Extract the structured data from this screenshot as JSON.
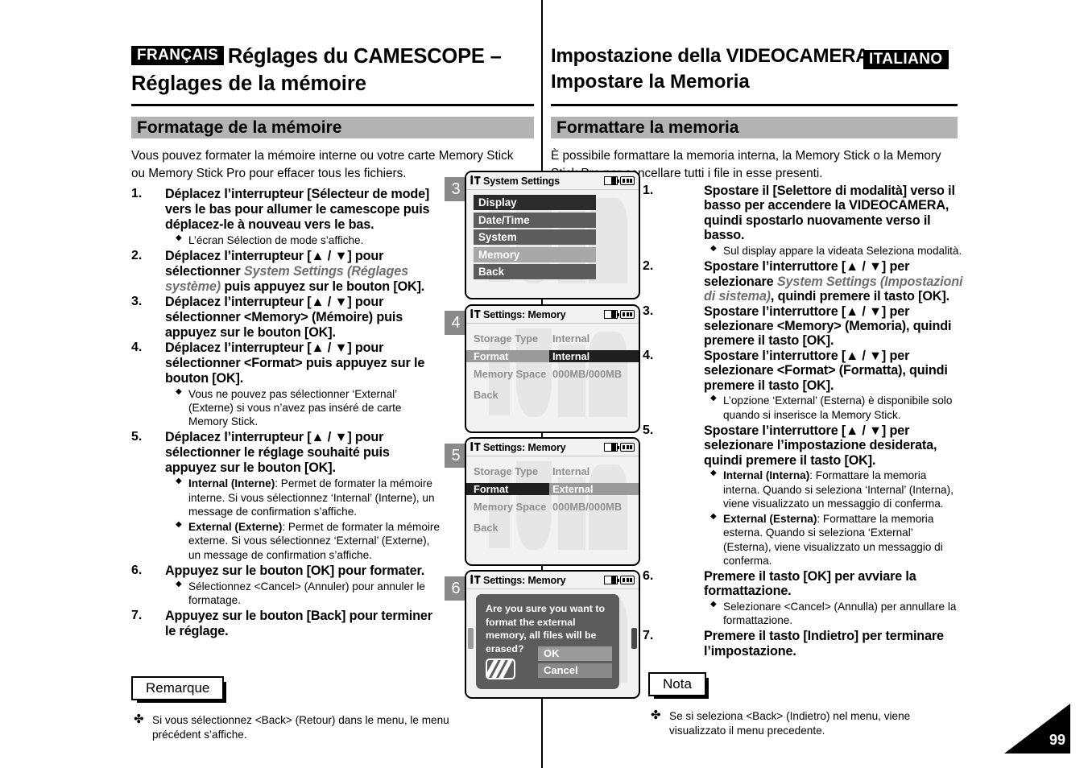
{
  "headers": {
    "french": {
      "lang_tag": "FRANÇAIS",
      "title_line1": "Réglages du CAMESCOPE –",
      "title_line2": "Réglages de la mémoire",
      "section_bar": "Formatage de la mémoire",
      "intro": "Vous pouvez formater la mémoire interne ou votre carte Memory Stick ou Memory Stick Pro pour effacer tous les fichiers."
    },
    "italian": {
      "lang_tag": "ITALIANO",
      "title_line1": "Impostazione della VIDEOCAMERA:",
      "title_line2": "Impostare la Memoria",
      "section_bar": "Formattare la memoria",
      "intro": "È possibile formattare la memoria interna, la Memory Stick o la Memory Stick Pro per cancellare tutti i file in esse presenti."
    }
  },
  "french_steps": [
    {
      "num": "1.",
      "text_pre": "Déplacez l’interrupteur [Sélecteur de mode] vers le bas pour allumer le camescope puis déplacez-le à nouveau vers le bas.",
      "italic": "",
      "text_post": "",
      "bullets": [
        {
          "pre": "",
          "bold": "",
          "post": "L’écran Sélection de mode s’affiche."
        }
      ]
    },
    {
      "num": "2.",
      "text_pre": "Déplacez l’interrupteur [▲ / ▼] pour sélectionner ",
      "italic": "System Settings (Réglages système)",
      "text_post": " puis appuyez sur le bouton [OK].",
      "bullets": []
    },
    {
      "num": "3.",
      "text_pre": "Déplacez l’interrupteur [▲ / ▼] pour sélectionner <Memory> (Mémoire) puis appuyez sur le bouton [OK].",
      "italic": "",
      "text_post": "",
      "bullets": []
    },
    {
      "num": "4.",
      "text_pre": "Déplacez l’interrupteur [▲ / ▼] pour sélectionner <Format> puis appuyez sur le bouton [OK].",
      "italic": "",
      "text_post": "",
      "bullets": [
        {
          "pre": "",
          "bold": "",
          "post": "Vous ne pouvez pas sélectionner ‘External’ (Externe) si vous n’avez pas inséré de carte Memory Stick."
        }
      ]
    },
    {
      "num": "5.",
      "text_pre": "Déplacez l’interrupteur [▲ / ▼] pour sélectionner le réglage souhaité puis appuyez sur le bouton [OK].",
      "italic": "",
      "text_post": "",
      "bullets": [
        {
          "pre": "",
          "bold": "Internal (Interne)",
          "post": ": Permet de formater la mémoire interne. Si vous sélectionnez ‘Internal’ (Interne), un message de confirmation s’affiche."
        },
        {
          "pre": "",
          "bold": "External (Externe)",
          "post": ": Permet de formater la mémoire externe. Si vous sélectionnez ‘External’ (Externe), un message de confirmation s’affiche."
        }
      ]
    },
    {
      "num": "6.",
      "text_pre": "Appuyez sur le bouton [OK] pour formater.",
      "italic": "",
      "text_post": "",
      "bullets": [
        {
          "pre": "",
          "bold": "",
          "post": "Sélectionnez <Cancel> (Annuler) pour annuler le formatage."
        }
      ]
    },
    {
      "num": "7.",
      "text_pre": "Appuyez sur le bouton [Back] pour terminer le réglage.",
      "italic": "",
      "text_post": "",
      "bullets": []
    }
  ],
  "italian_steps": [
    {
      "num": "1.",
      "text_pre": "Spostare il [Selettore di modalità]  verso il basso per accendere la VIDEOCAMERA, quindi  spostarlo nuovamente verso il basso.",
      "italic": "",
      "text_post": "",
      "bullets": [
        {
          "pre": "",
          "bold": "",
          "post": "Sul display appare la videata Seleziona modalità."
        }
      ]
    },
    {
      "num": "2.",
      "text_pre": "Spostare l’interruttore [▲ / ▼] per selezionare ",
      "italic": "System Settings (Impostazioni di sistema)",
      "text_post": ", quindi premere il tasto [OK].",
      "bullets": []
    },
    {
      "num": "3.",
      "text_pre": "Spostare l’interruttore [▲ / ▼] per selezionare <Memory> (Memoria), quindi premere il tasto [OK].",
      "italic": "",
      "text_post": "",
      "bullets": []
    },
    {
      "num": "4.",
      "text_pre": "Spostare l’interruttore [▲ / ▼] per selezionare <Format> (Formatta), quindi premere il tasto [OK].",
      "italic": "",
      "text_post": "",
      "bullets": [
        {
          "pre": "",
          "bold": "",
          "post": "L’opzione ‘External’ (Esterna) è disponibile solo quando si inserisce la Memory Stick."
        }
      ]
    },
    {
      "num": "5.",
      "text_pre": "Spostare l’interruttore [▲ / ▼] per selezionare l’impostazione desiderata, quindi premere il tasto [OK].",
      "italic": "",
      "text_post": "",
      "bullets": [
        {
          "pre": "",
          "bold": "Internal (Interna)",
          "post": ": Formattare la memoria interna. Quando si seleziona ‘Internal’ (Interna), viene visualizzato un messaggio di conferma."
        },
        {
          "pre": "",
          "bold": "External (Esterna)",
          "post": ": Formattare la memoria esterna. Quando si seleziona ‘External’ (Esterna), viene visualizzato un messaggio di conferma."
        }
      ]
    },
    {
      "num": "6.",
      "text_pre": "Premere il tasto [OK] per avviare la formattazione.",
      "italic": "",
      "text_post": "",
      "bullets": [
        {
          "pre": "",
          "bold": "",
          "post": "Selezionare <Cancel> (Annulla) per annullare la formattazione."
        }
      ]
    },
    {
      "num": "7.",
      "text_pre": "Premere il tasto [Indietro] per terminare l’impostazione.",
      "italic": "",
      "text_post": "",
      "bullets": []
    }
  ],
  "notes": {
    "french": {
      "tab": "Remarque",
      "mark": "✤",
      "text": "Si vous sélectionnez <Back> (Retour) dans le menu, le menu précédent s’affiche."
    },
    "italian": {
      "tab": "Nota",
      "mark": "✤",
      "text": "Se si seleziona <Back> (Indietro) nel menu, viene visualizzato il menu precedente."
    }
  },
  "screens": [
    {
      "badge": "3",
      "title": "System Settings",
      "type": "menu",
      "items": [
        {
          "label": "Display",
          "style": "mi-dark"
        },
        {
          "label": "Date/Time",
          "style": "mi-mid"
        },
        {
          "label": "System",
          "style": "mi-mid"
        },
        {
          "label": "Memory",
          "style": "mi-light"
        },
        {
          "label": "Back",
          "style": "mi-mid"
        }
      ]
    },
    {
      "badge": "4",
      "title": "Settings: Memory",
      "type": "settings",
      "rows": [
        {
          "label": "Storage Type",
          "value": "Internal",
          "state": ""
        },
        {
          "label": "Format",
          "value": "Internal",
          "state": "sel"
        },
        {
          "label": "Memory Space",
          "value": "000MB/000MB",
          "state": ""
        },
        {
          "label": "Back",
          "value": "",
          "state": "gap"
        }
      ]
    },
    {
      "badge": "5",
      "title": "Settings: Memory",
      "type": "settings",
      "rows": [
        {
          "label": "Storage Type",
          "value": "Internal",
          "state": ""
        },
        {
          "label": "Format",
          "value": "External",
          "state": "sel2"
        },
        {
          "label": "Memory Space",
          "value": "000MB/000MB",
          "state": ""
        },
        {
          "label": "Back",
          "value": "",
          "state": "gap"
        }
      ]
    },
    {
      "badge": "6",
      "title": "Settings: Memory",
      "type": "dialog",
      "message": "Are you sure you want to format the external memory, all files will be erased?",
      "ok_label": "OK",
      "cancel_label": "Cancel"
    }
  ],
  "page_number": "99",
  "colors": {
    "section_bar": "#b3b3b3",
    "step_badge": "#8a8a8a",
    "italic_text": "#6e6e6e",
    "lcd_bg": "#f2f2f2",
    "menu_dark": "#2b2b2b",
    "menu_mid": "#5c5c5c",
    "menu_light": "#a8a8a8"
  }
}
